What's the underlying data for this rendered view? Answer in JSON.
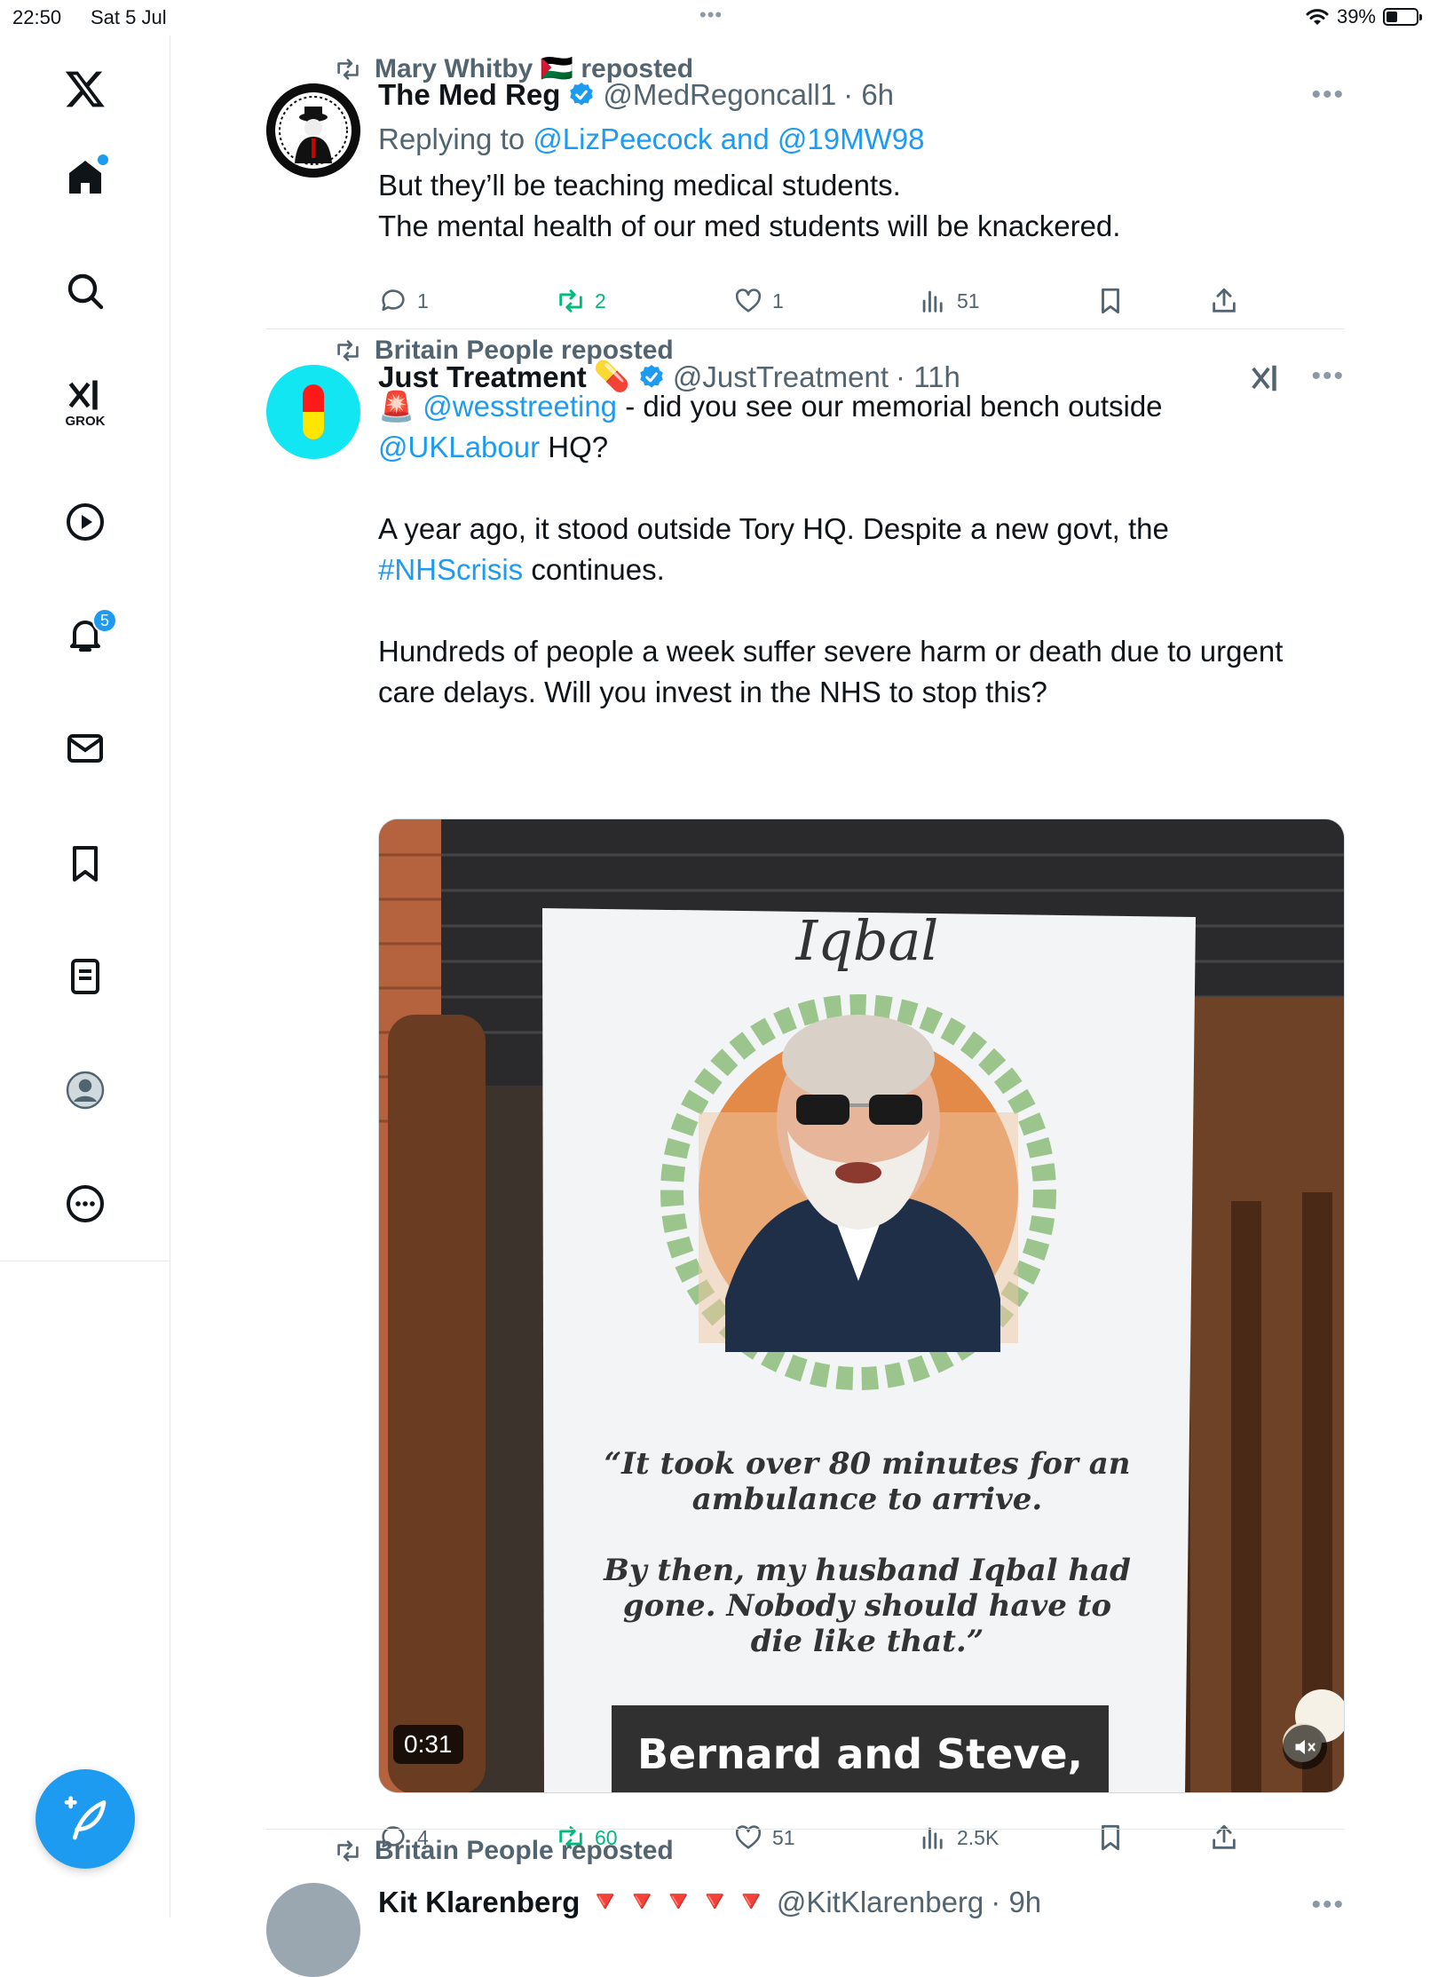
{
  "status": {
    "time": "22:50",
    "date": "Sat 5 Jul",
    "battery": "39%",
    "battery_level": 0.39
  },
  "sidebar": {
    "grok_label": "GROK",
    "notifications_count": "5"
  },
  "tweets": [
    {
      "reposted_by": "Mary Whitby 🇵🇸 reposted",
      "name": "The Med Reg",
      "handle": "@MedRegoncall1",
      "time": "· 6h",
      "replying_prefix": "Replying to",
      "replying_to": "@LizPeecock and @19MW98",
      "text_line1": "But they’ll be teaching medical students.",
      "text_line2": "The mental health of our med students will be knackered.",
      "replies": "1",
      "reposts": "2",
      "likes": "1",
      "views": "51"
    },
    {
      "reposted_by": "Britain People reposted",
      "name": "Just Treatment",
      "name_emoji": "💊",
      "handle": "@JustTreatment",
      "time": "· 11h",
      "siren": "🚨",
      "mention1": "@wesstreeting",
      "text_a": " - did you see our memorial bench outside",
      "mention2": "@UKLabour",
      "text_b": " HQ?",
      "text_c": "A year ago, it stood outside Tory HQ. Despite a new govt, the",
      "hashtag": "#NHScrisis",
      "text_d": " continues.",
      "text_e1": "Hundreds of people a week suffer severe harm or death due to urgent",
      "text_e2": "care delays. Will you invest in the NHS to stop this?",
      "video": {
        "duration": "0:31",
        "caption": "Bernard and Steve,",
        "poster_name": "Iqbal",
        "poster_quote1": "“It took over 80 minutes for an",
        "poster_quote2": "ambulance to arrive.",
        "poster_quote3": "By then, my husband Iqbal had",
        "poster_quote4": "gone. Nobody should have to",
        "poster_quote5": "die like that.”"
      },
      "replies": "4",
      "reposts": "60",
      "likes": "51",
      "views": "2.5K"
    },
    {
      "reposted_by": "Britain People reposted",
      "name": "Kit Klarenberg",
      "name_emoji": "🔻🔻🔻🔻🔻",
      "handle": "@KitKlarenberg",
      "time": "· 9h"
    }
  ],
  "colors": {
    "accent": "#1d9bf0",
    "secondary_text": "#536471",
    "repost_green": "#00ba7c"
  }
}
